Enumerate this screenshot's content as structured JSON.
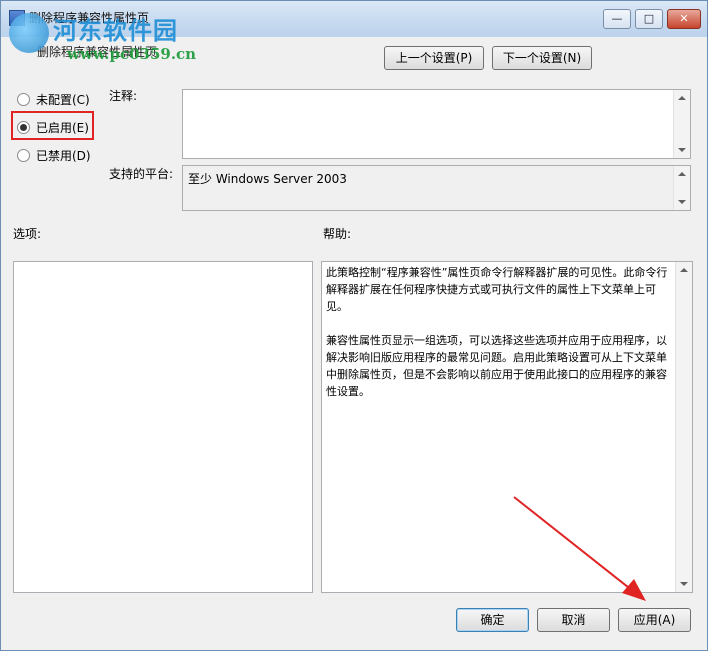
{
  "window": {
    "title": "删除程序兼容性属性页",
    "subtitle": "删除程序兼容性属性页",
    "minimize": "—",
    "maximize": "□",
    "close": "✕"
  },
  "watermark": {
    "brand": "河东软件园",
    "url": "www.pc0359.cn"
  },
  "nav": {
    "prev": "上一个设置(P)",
    "next": "下一个设置(N)"
  },
  "state": {
    "options": [
      {
        "label": "未配置(C)",
        "checked": false
      },
      {
        "label": "已启用(E)",
        "checked": true
      },
      {
        "label": "已禁用(D)",
        "checked": false
      }
    ]
  },
  "comment": {
    "label": "注释:",
    "value": ""
  },
  "platform": {
    "label": "支持的平台:",
    "value": "至少 Windows Server 2003"
  },
  "options_label": "选项:",
  "help": {
    "label": "帮助:",
    "p1": "此策略控制“程序兼容性”属性页命令行解释器扩展的可见性。此命令行解释器扩展在任何程序快捷方式或可执行文件的属性上下文菜单上可见。",
    "p2": "兼容性属性页显示一组选项，可以选择这些选项并应用于应用程序，以解决影响旧版应用程序的最常见问题。启用此策略设置可从上下文菜单中删除属性页，但是不会影响以前应用于使用此接口的应用程序的兼容性设置。"
  },
  "footer": {
    "ok": "确定",
    "cancel": "取消",
    "apply": "应用(A)"
  },
  "colors": {
    "highlight": "#e02424",
    "arrow": "#e02424"
  }
}
